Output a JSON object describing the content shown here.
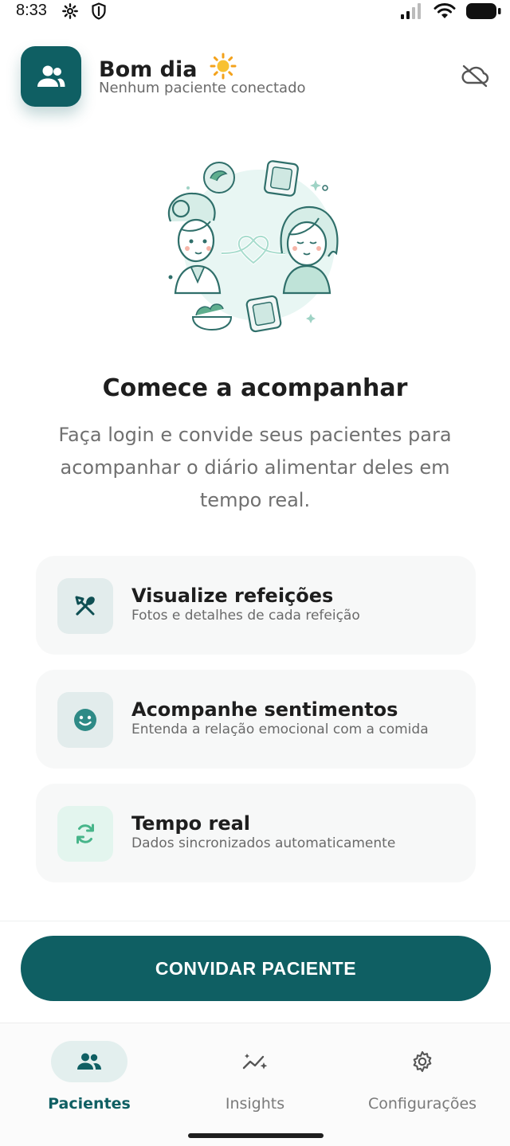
{
  "status_bar": {
    "time": "8:33"
  },
  "header": {
    "greeting": "Bom dia",
    "subtitle": "Nenhum paciente conectado"
  },
  "empty_state": {
    "title": "Comece a acompanhar",
    "description": "Faça login e convide seus pacientes para acompanhar o diário alimentar deles em tempo real."
  },
  "features": [
    {
      "title": "Visualize refeições",
      "subtitle": "Fotos e detalhes de cada refeição",
      "icon": "fork-knife-icon"
    },
    {
      "title": "Acompanhe sentimentos",
      "subtitle": "Entenda a relação emocional com a comida",
      "icon": "smile-icon"
    },
    {
      "title": "Tempo real",
      "subtitle": "Dados sincronizados automaticamente",
      "icon": "sync-icon"
    }
  ],
  "cta": {
    "label": "CONVIDAR PACIENTE"
  },
  "nav": {
    "items": [
      {
        "label": "Pacientes",
        "icon": "people-icon",
        "active": true
      },
      {
        "label": "Insights",
        "icon": "sparkle-chart-icon",
        "active": false
      },
      {
        "label": "Configurações",
        "icon": "gear-icon",
        "active": false
      }
    ]
  },
  "colors": {
    "primary": "#0f5f63",
    "card_bg": "#f7f8f8",
    "muted_text": "#707070"
  }
}
